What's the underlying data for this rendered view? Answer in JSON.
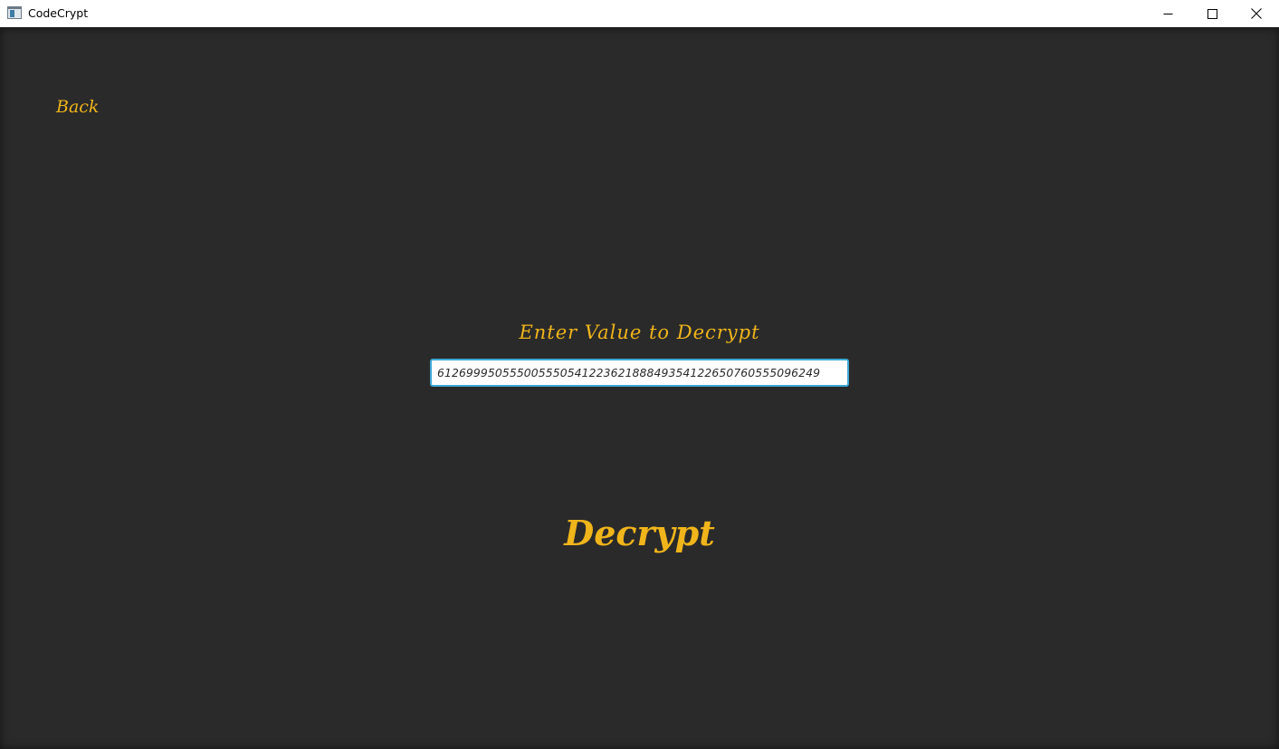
{
  "window": {
    "title": "CodeCrypt",
    "icon": "app-window-icon",
    "controls": {
      "minimize_icon": "minimize-icon",
      "maximize_icon": "maximize-icon",
      "close_icon": "close-icon"
    }
  },
  "nav": {
    "back_label": "Back"
  },
  "form": {
    "prompt": "Enter Value to Decrypt",
    "input_value": "61269995055500555054122362188849354122650760555096249",
    "submit_label": "Decrypt"
  },
  "colors": {
    "background": "#2a2a2a",
    "accent": "#f0b51b",
    "input_focus_border": "#3ea9d6",
    "titlebar": "#ffffff"
  }
}
